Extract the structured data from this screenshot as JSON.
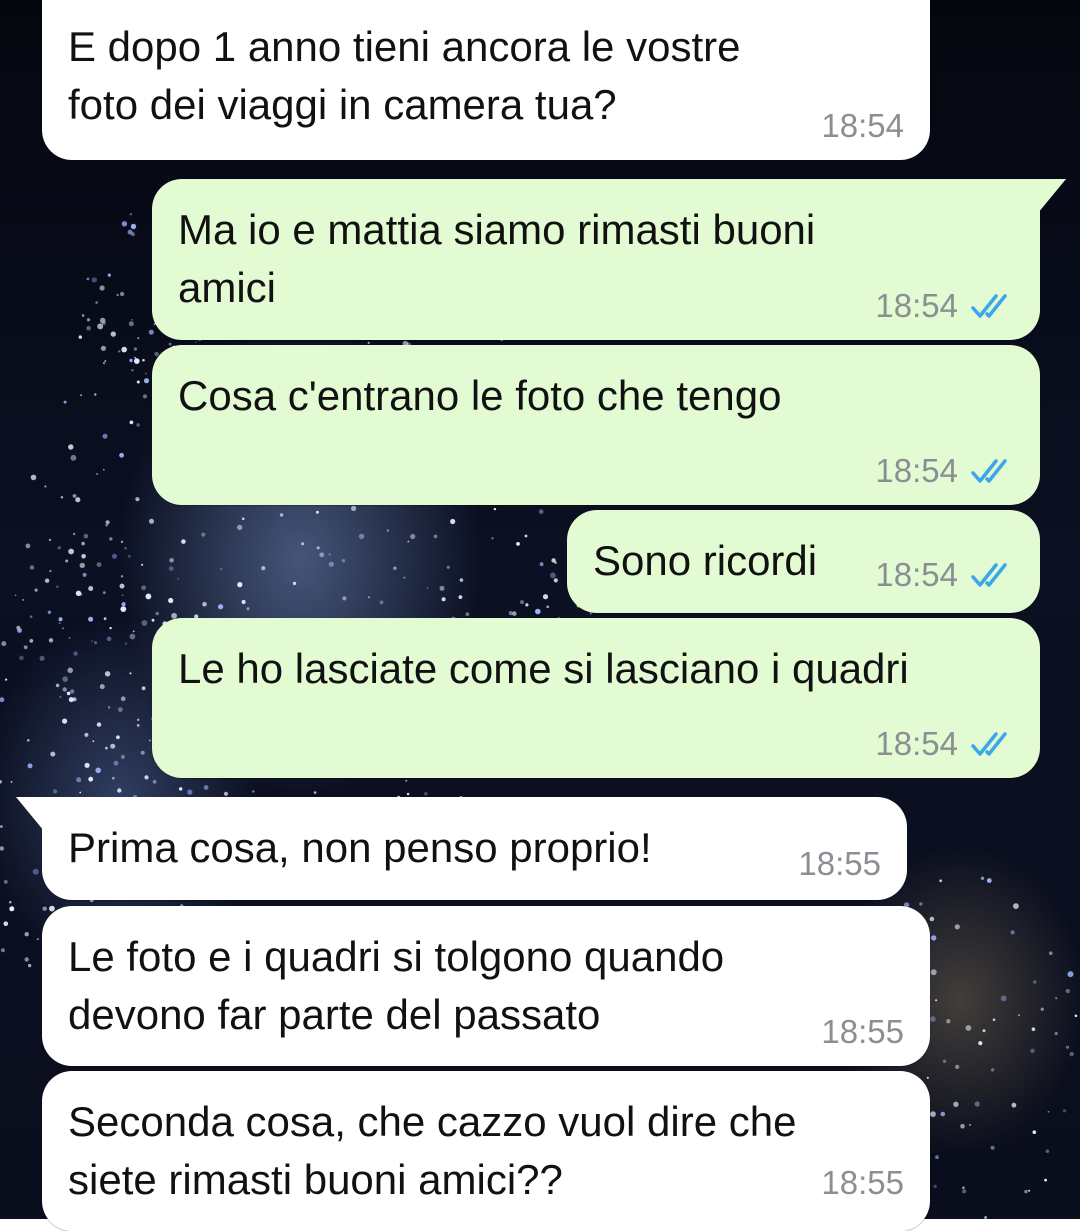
{
  "colors": {
    "incoming_bubble": "#ffffff",
    "outgoing_bubble": "#e3fbd3",
    "read_ticks": "#3aa7e8",
    "timestamp": "#8b8f93"
  },
  "messages": [
    {
      "direction": "incoming",
      "text": "E dopo 1 anno tieni ancora le vostre\nfoto dei viaggi in camera tua?",
      "time": "18:54"
    },
    {
      "direction": "outgoing",
      "text": "Ma io e mattia siamo rimasti buoni\namici",
      "time": "18:54",
      "status": "read-double-check-icon"
    },
    {
      "direction": "outgoing",
      "text": "Cosa c'entrano le foto che tengo",
      "time": "18:54",
      "status": "read-double-check-icon"
    },
    {
      "direction": "outgoing",
      "text": "Sono ricordi",
      "time": "18:54",
      "status": "read-double-check-icon"
    },
    {
      "direction": "outgoing",
      "text": "Le ho lasciate come si lasciano i quadri",
      "time": "18:54",
      "status": "read-double-check-icon"
    },
    {
      "direction": "incoming",
      "text": "Prima cosa, non penso proprio!",
      "time": "18:55"
    },
    {
      "direction": "incoming",
      "text": "Le foto e i quadri si tolgono quando\ndevono far parte del passato",
      "time": "18:55"
    },
    {
      "direction": "incoming",
      "text": "Seconda cosa, che cazzo vuol dire che\nsiete rimasti buoni amici??",
      "time": "18:55"
    }
  ]
}
